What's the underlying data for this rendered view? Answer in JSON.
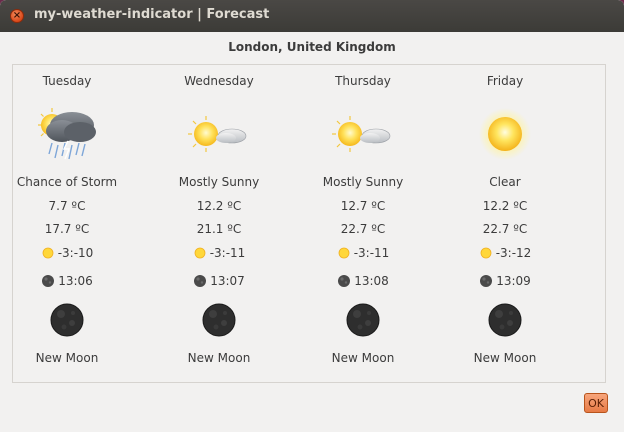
{
  "window": {
    "title": "my-weather-indicator | Forecast",
    "close_glyph": "×"
  },
  "location": "London, United Kingdom",
  "days": [
    {
      "name": "Tuesday",
      "icon": "storm-cloud-icon",
      "condition": "Chance of Storm",
      "temp_low": "7.7 ºC",
      "temp_high": "17.7 ºC",
      "sun_time": "-3:-10",
      "moon_time": "13:06",
      "moon_phase": "New Moon"
    },
    {
      "name": "Wednesday",
      "icon": "mostly-sunny-icon",
      "condition": "Mostly Sunny",
      "temp_low": "12.2 ºC",
      "temp_high": "21.1 ºC",
      "sun_time": "-3:-11",
      "moon_time": "13:07",
      "moon_phase": "New Moon"
    },
    {
      "name": "Thursday",
      "icon": "mostly-sunny-icon",
      "condition": "Mostly Sunny",
      "temp_low": "12.7 ºC",
      "temp_high": "22.7 ºC",
      "sun_time": "-3:-11",
      "moon_time": "13:08",
      "moon_phase": "New Moon"
    },
    {
      "name": "Friday",
      "icon": "sun-icon",
      "condition": "Clear",
      "temp_low": "12.2 ºC",
      "temp_high": "22.7 ºC",
      "sun_time": "-3:-12",
      "moon_time": "13:09",
      "moon_phase": "New Moon"
    }
  ],
  "buttons": {
    "ok": "OK"
  },
  "colors": {
    "titlebar": "#3c3b37",
    "background": "#f2f1f0",
    "close": "#e05a26",
    "ok_button": "#ef8a5a"
  }
}
